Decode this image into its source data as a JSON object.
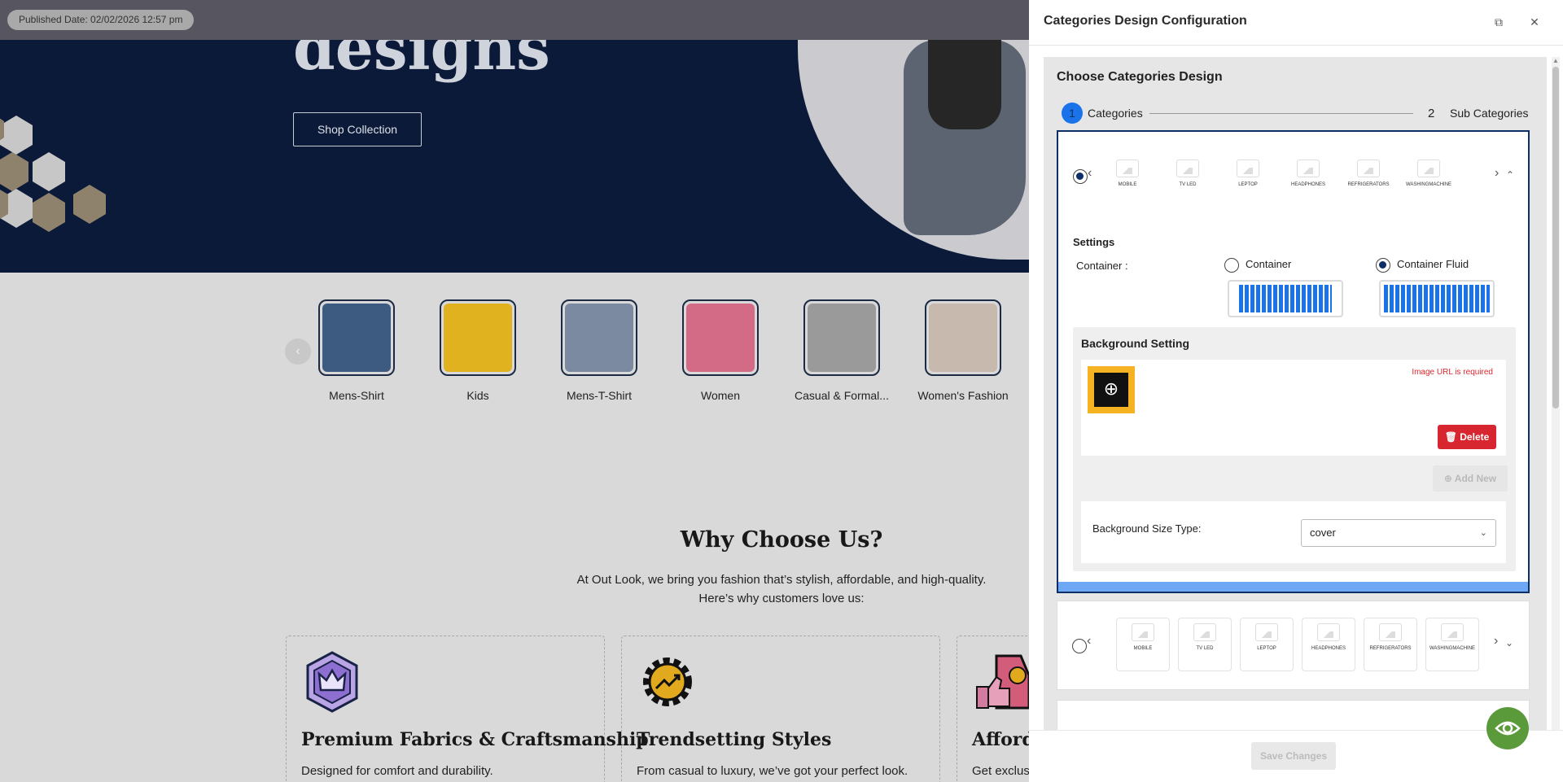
{
  "background_page": {
    "published_date": "Published Date: 02/02/2026 12:57 pm",
    "hero_title": "designs",
    "shop_button": "Shop Collection",
    "categories": [
      {
        "name": "Mens-Shirt",
        "color": "#3d5a80"
      },
      {
        "name": "Kids",
        "color": "#e0b21f"
      },
      {
        "name": "Mens-T-Shirt",
        "color": "#7b8aa0"
      },
      {
        "name": "Women",
        "color": "#d36b86"
      },
      {
        "name": "Casual & Formal...",
        "color": "#9a9a9a"
      },
      {
        "name": "Women's Fashion",
        "color": "#c7b9ad"
      }
    ],
    "why_title": "Why Choose Us?",
    "why_subtitle_1": "At Out Look, we bring you fashion that’s stylish, affordable, and high-quality.",
    "why_subtitle_2": "Here’s why customers love us:",
    "features": [
      {
        "title": "Premium Fabrics & Craftsmanship",
        "desc": "Designed for comfort and durability.",
        "icon": "crown-badge-icon"
      },
      {
        "title": "Trendsetting Styles",
        "desc": "From casual to luxury, we’ve got your perfect look.",
        "icon": "gear-trend-icon"
      },
      {
        "title": "Afforda",
        "desc": "Get exclus",
        "icon": "price-tag-thumbs-up-icon"
      }
    ]
  },
  "drawer": {
    "title": "Categories Design Configuration",
    "choose_title": "Choose Categories Design",
    "steps": [
      {
        "num": "1",
        "label": "Categories"
      },
      {
        "num": "2",
        "label": "Sub Categories"
      }
    ],
    "design_thumbs": [
      "MOBILE",
      "TV LED",
      "LEPTOP",
      "HEADPHONES",
      "REFRIGERATORS",
      "WASHINGMACHINE"
    ],
    "design_thumbs_arrow": [
      "MOBILE",
      "TV LED",
      "LEPTOP"
    ],
    "settings_label": "Settings",
    "container_label": "Container :",
    "container_options": [
      "Container",
      "Container Fluid"
    ],
    "selected_container": "Container Fluid",
    "background_setting_title": "Background Setting",
    "image_error": "Image URL is required",
    "delete_label": "Delete",
    "add_new_label": "Add New",
    "bg_size_label": "Background Size Type:",
    "bg_size_value": "cover",
    "save_label": "Save Changes"
  },
  "colors": {
    "accent_blue": "#1a73e8",
    "selected_border": "#0c2f66",
    "delete_red": "#d7262f",
    "fab_green": "#5b9a3b",
    "upload_yellow": "#f5b324"
  }
}
